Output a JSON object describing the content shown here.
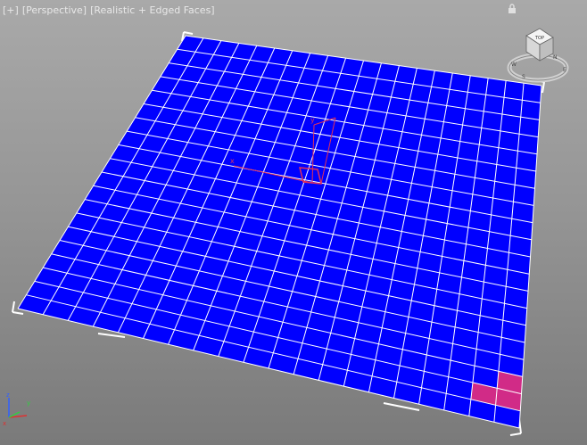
{
  "viewport": {
    "label": {
      "menu": "[+]",
      "view": "[Perspective]",
      "shading": "[Realistic + Edged Faces]"
    },
    "plane": {
      "rows": 20,
      "cols": 20,
      "face_color": "#0000ff",
      "edge_color": "#ffffff",
      "selected_color": "#e8307a"
    },
    "gizmo": {
      "color": "#e0305a",
      "axis_x": "x",
      "axis_y": "y"
    },
    "viewcube": {
      "face_label": "TOP",
      "compass_letters": [
        "N",
        "E",
        "S",
        "W"
      ]
    },
    "axis_tripod": {
      "x_label": "x",
      "y_label": "y",
      "z_label": "z",
      "x_color": "#e03030",
      "y_color": "#30d040",
      "z_color": "#3060ff"
    }
  }
}
